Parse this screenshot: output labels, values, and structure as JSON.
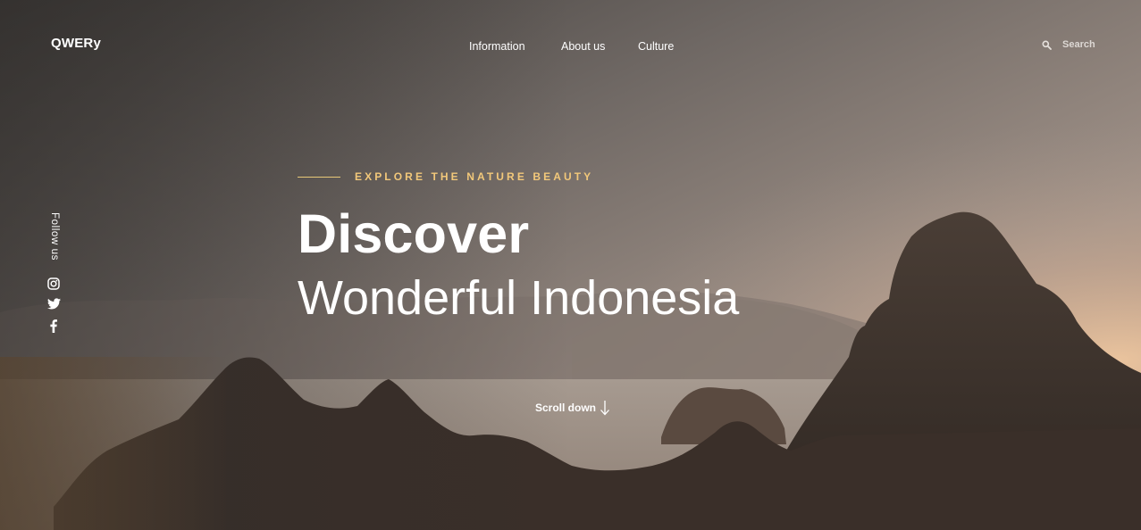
{
  "brand": {
    "logo_text": "QWERy"
  },
  "nav": {
    "items": [
      {
        "label": "Information"
      },
      {
        "label": "About us"
      },
      {
        "label": "Culture"
      }
    ]
  },
  "search": {
    "label": "Search",
    "icon": "search-icon"
  },
  "social": {
    "follow_label": "Follow us",
    "icons": [
      "instagram-icon",
      "twitter-icon",
      "facebook-icon"
    ]
  },
  "hero": {
    "eyebrow": "EXPLORE THE NATURE BEAUTY",
    "title": "Discover",
    "subtitle": "Wonderful Indonesia",
    "scroll_label": "Scroll down",
    "scroll_icon": "arrow-down-icon"
  },
  "colors": {
    "accent": "#f2c87a",
    "text": "#ffffff"
  }
}
